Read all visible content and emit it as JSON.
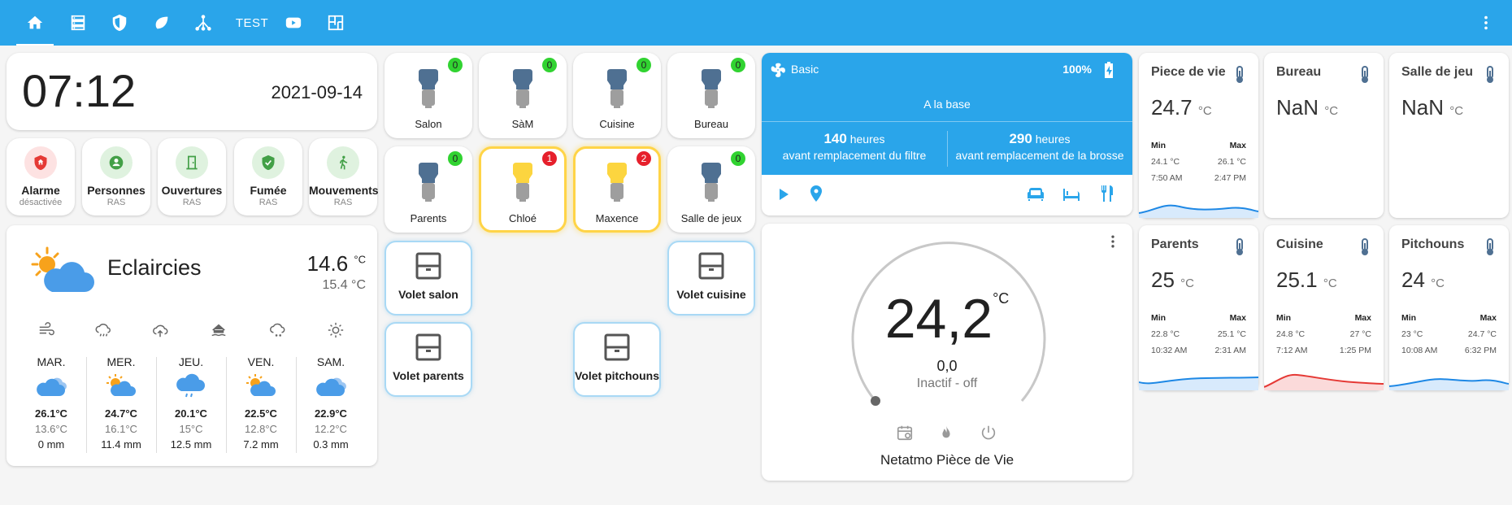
{
  "topbar": {
    "tabs": [
      {
        "icon": "home-icon",
        "active": true
      },
      {
        "icon": "server-icon"
      },
      {
        "icon": "shield-icon"
      },
      {
        "icon": "leaf-icon"
      },
      {
        "icon": "network-icon"
      },
      {
        "label": "TEST"
      },
      {
        "icon": "youtube-icon"
      },
      {
        "icon": "floorplan-icon"
      }
    ],
    "menu_icon": "dots-vertical-icon"
  },
  "clock": {
    "time": "07:12",
    "date": "2021-09-14"
  },
  "status": [
    {
      "name": "Alarme",
      "sub": "désactivée",
      "icon": "shield-home-icon",
      "color": "#e53935",
      "bg": "#fde2e2"
    },
    {
      "name": "Personnes",
      "sub": "RAS",
      "icon": "person-icon",
      "color": "#43a047",
      "bg": "#dff2df"
    },
    {
      "name": "Ouvertures",
      "sub": "RAS",
      "icon": "door-icon",
      "color": "#43a047",
      "bg": "#dff2df"
    },
    {
      "name": "Fumée",
      "sub": "RAS",
      "icon": "shield-check-icon",
      "color": "#43a047",
      "bg": "#dff2df"
    },
    {
      "name": "Mouvements",
      "sub": "RAS",
      "icon": "walk-icon",
      "color": "#43a047",
      "bg": "#dff2df"
    }
  ],
  "weather": {
    "condition": "Eclaircies",
    "temp": "14.6",
    "unit": "°C",
    "temp2": "15.4 °C",
    "attributes": [
      "wind-icon",
      "rain-icon",
      "cloud-upload-icon",
      "home-flood-icon",
      "snow-cloud-icon",
      "sun-icon"
    ],
    "forecast": [
      {
        "day": "MAR.",
        "icon": "cloudy-icon",
        "high": "26.1°C",
        "low": "13.6°C",
        "rain": "0 mm"
      },
      {
        "day": "MER.",
        "icon": "partly-cloudy-icon",
        "high": "24.7°C",
        "low": "16.1°C",
        "rain": "11.4 mm"
      },
      {
        "day": "JEU.",
        "icon": "rainy-icon",
        "high": "20.1°C",
        "low": "15°C",
        "rain": "12.5 mm"
      },
      {
        "day": "VEN.",
        "icon": "partly-cloudy-icon",
        "high": "22.5°C",
        "low": "12.8°C",
        "rain": "7.2 mm"
      },
      {
        "day": "SAM.",
        "icon": "cloudy-icon",
        "high": "22.9°C",
        "low": "12.2°C",
        "rain": "0.3 mm"
      }
    ]
  },
  "lights": [
    {
      "name": "Salon",
      "count": "0",
      "on": false
    },
    {
      "name": "SàM",
      "count": "0",
      "on": false
    },
    {
      "name": "Cuisine",
      "count": "0",
      "on": false
    },
    {
      "name": "Bureau",
      "count": "0",
      "on": false
    },
    {
      "name": "Parents",
      "count": "0",
      "on": false
    },
    {
      "name": "Chloé",
      "count": "1",
      "on": true
    },
    {
      "name": "Maxence",
      "count": "2",
      "on": true
    },
    {
      "name": "Salle de jeux",
      "count": "0",
      "on": false
    }
  ],
  "volets": [
    {
      "name": "Volet salon"
    },
    {
      "name": "Volet cuisine"
    },
    {
      "name": "Volet parents"
    },
    {
      "name": "Volet pitchouns"
    }
  ],
  "vacuum": {
    "name": "Basic",
    "battery": "100%",
    "status": "A la base",
    "filter_hours": "140",
    "filter_unit": "heures",
    "filter_label": "avant remplacement du filtre",
    "brush_hours": "290",
    "brush_unit": "heures",
    "brush_label": "avant remplacement de la brosse",
    "actions": [
      "play-icon",
      "locate-icon",
      "sofa-icon",
      "bed-icon",
      "cutlery-icon"
    ]
  },
  "thermostat": {
    "temp": "24,2",
    "unit": "°C",
    "setpoint": "0,0",
    "state": "Inactif - off",
    "name": "Netatmo Pièce de Vie",
    "controls": [
      "calendar-sync-icon",
      "fire-icon",
      "power-icon"
    ]
  },
  "sensors": [
    {
      "name": "Piece de vie",
      "value": "24.7",
      "unit": "°C",
      "min_label": "Min",
      "max_label": "Max",
      "min": "24.1 °C",
      "max": "26.1 °C",
      "min_time": "7:50 AM",
      "max_time": "2:47 PM",
      "color": "#1e88e5"
    },
    {
      "name": "Bureau",
      "value": "NaN",
      "unit": "°C"
    },
    {
      "name": "Salle de jeu",
      "value": "NaN",
      "unit": "°C"
    },
    {
      "name": "Parents",
      "value": "25",
      "unit": "°C",
      "min_label": "Min",
      "max_label": "Max",
      "min": "22.8 °C",
      "max": "25.1 °C",
      "min_time": "10:32 AM",
      "max_time": "2:31 AM",
      "color": "#1e88e5"
    },
    {
      "name": "Cuisine",
      "value": "25.1",
      "unit": "°C",
      "min_label": "Min",
      "max_label": "Max",
      "min": "24.8 °C",
      "max": "27 °C",
      "min_time": "7:12 AM",
      "max_time": "1:25 PM",
      "color": "#e53935"
    },
    {
      "name": "Pitchouns",
      "value": "24",
      "unit": "°C",
      "min_label": "Min",
      "max_label": "Max",
      "min": "23 °C",
      "max": "24.7 °C",
      "min_time": "10:08 AM",
      "max_time": "6:32 PM",
      "color": "#1e88e5"
    }
  ]
}
